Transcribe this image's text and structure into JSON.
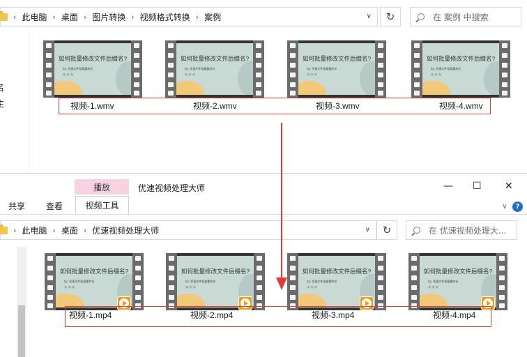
{
  "top_window": {
    "breadcrumb": [
      "此电脑",
      "桌面",
      "图片转换",
      "视频格式转换",
      "案例"
    ],
    "search_placeholder": "在 案例 中搜索",
    "left_cut_text": [
      "名",
      "生"
    ],
    "files": [
      "视频-1.wmv",
      "视频-2.wmv",
      "视频-3.wmv",
      "视频-4.wmv"
    ]
  },
  "thumbnail": {
    "slide_title": "如何批量修改文件后缀名?",
    "slide_sub": "by: 优速文件批量重命名",
    "slide_dots": "●●●"
  },
  "bottom_window": {
    "context_tab": "播放",
    "title": "优速视频处理大师",
    "ribbon_tabs": [
      "共享",
      "查看",
      "视频工具"
    ],
    "breadcrumb": [
      "此电脑",
      "桌面",
      "优速视频处理大师"
    ],
    "search_placeholder": "在 优速视频处理大...",
    "files": [
      "视频-1.mp4",
      "视频-2.mp4",
      "视频-3.mp4",
      "视频-4.mp4"
    ],
    "help": "?"
  },
  "icons": {
    "refresh": "↻",
    "dropdown": "∨",
    "separator": "›",
    "minimize": "—",
    "maximize": "☐",
    "close": "✕"
  }
}
